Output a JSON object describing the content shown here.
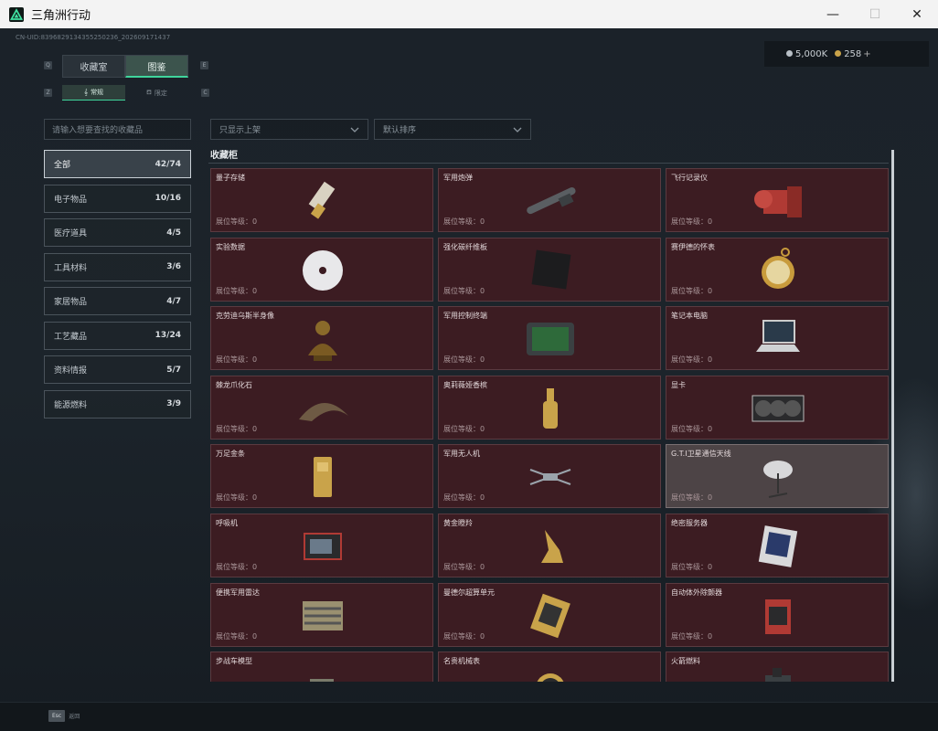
{
  "window": {
    "title": "三角洲行动",
    "min": "—",
    "max": "☐",
    "close": "✕"
  },
  "build_id": "CN-UID:8396829134355250236_202609171437",
  "currency": {
    "silver": "5,000K",
    "gold": "258",
    "plus": "+"
  },
  "key_hints": {
    "q": "Q",
    "e": "E",
    "z": "Z",
    "c": "C"
  },
  "tabs": [
    {
      "label": "收藏室"
    },
    {
      "label": "图鉴"
    }
  ],
  "subtabs": [
    {
      "label": "常规",
      "icon": "𝄞"
    },
    {
      "label": "限定",
      "icon": "⛾"
    }
  ],
  "search": {
    "placeholder": "请输入想要查找的收藏品"
  },
  "filters": {
    "shelf": "只显示上架",
    "sort": "默认排序"
  },
  "categories": [
    {
      "label": "全部",
      "count": "42/74"
    },
    {
      "label": "电子物品",
      "count": "10/16"
    },
    {
      "label": "医疗道具",
      "count": "4/5"
    },
    {
      "label": "工具材料",
      "count": "3/6"
    },
    {
      "label": "家居物品",
      "count": "4/7"
    },
    {
      "label": "工艺藏品",
      "count": "13/24"
    },
    {
      "label": "资料情报",
      "count": "5/7"
    },
    {
      "label": "能源燃料",
      "count": "3/9"
    }
  ],
  "section_title": "收藏柜",
  "level_prefix": "展位等级：0",
  "items": [
    {
      "name": "量子存储",
      "icon": "usb-drive-icon"
    },
    {
      "name": "军用炮弹",
      "icon": "artillery-shell-icon"
    },
    {
      "name": "飞行记录仪",
      "icon": "flight-recorder-icon"
    },
    {
      "name": "实验数据",
      "icon": "disc-icon"
    },
    {
      "name": "强化碳纤维板",
      "icon": "carbon-plate-icon"
    },
    {
      "name": "赛伊德的怀表",
      "icon": "pocket-watch-icon"
    },
    {
      "name": "克劳迪乌斯半身像",
      "icon": "bust-icon"
    },
    {
      "name": "军用控制终端",
      "icon": "control-terminal-icon"
    },
    {
      "name": "笔记本电脑",
      "icon": "laptop-icon"
    },
    {
      "name": "棘龙爪化石",
      "icon": "claw-fossil-icon"
    },
    {
      "name": "奥莉薇娅香槟",
      "icon": "champagne-icon"
    },
    {
      "name": "显卡",
      "icon": "graphics-card-icon"
    },
    {
      "name": "万足金条",
      "icon": "gold-bar-icon"
    },
    {
      "name": "军用无人机",
      "icon": "drone-icon"
    },
    {
      "name": "G.T.I卫星通信天线",
      "icon": "satellite-dish-icon"
    },
    {
      "name": "呼吸机",
      "icon": "ventilator-icon"
    },
    {
      "name": "黄金瞪羚",
      "icon": "gold-gazelle-icon"
    },
    {
      "name": "绝密服务器",
      "icon": "server-icon"
    },
    {
      "name": "便携军用雷达",
      "icon": "radar-icon"
    },
    {
      "name": "曼德尔超算单元",
      "icon": "compute-unit-icon"
    },
    {
      "name": "自动体外除颤器",
      "icon": "defibrillator-icon"
    },
    {
      "name": "步战车模型",
      "icon": "ifv-model-icon"
    },
    {
      "name": "名贵机械表",
      "icon": "wristwatch-icon"
    },
    {
      "name": "火箭燃料",
      "icon": "rocket-fuel-icon"
    }
  ],
  "footer": {
    "key": "Esc",
    "label": "返回"
  }
}
